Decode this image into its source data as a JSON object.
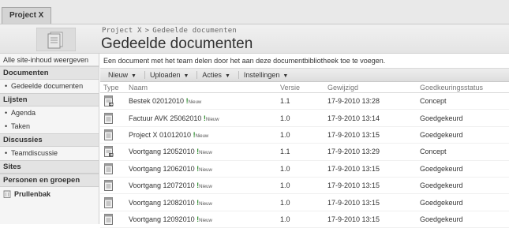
{
  "tab": {
    "label": "Project X"
  },
  "header": {
    "breadcrumb": [
      "Project X",
      "Gedeelde documenten"
    ],
    "breadcrumb_sep": ">",
    "title": "Gedeelde documenten"
  },
  "leftnav": {
    "all_content": "Alle site-inhoud weergeven",
    "sections": [
      {
        "heading": "Documenten",
        "items": [
          "Gedeelde documenten"
        ]
      },
      {
        "heading": "Lijsten",
        "items": [
          "Agenda",
          "Taken"
        ]
      },
      {
        "heading": "Discussies",
        "items": [
          "Teamdiscussie"
        ]
      },
      {
        "heading": "Sites",
        "items": []
      },
      {
        "heading": "Personen en groepen",
        "items": []
      }
    ],
    "recycle": "Prullenbak"
  },
  "main": {
    "description": "Een document met het team delen door het aan deze documentbibliotheek toe te voegen.",
    "toolbar": [
      "Nieuw",
      "Uploaden",
      "Acties",
      "Instellingen"
    ],
    "columns": [
      "Type",
      "Naam",
      "Versie",
      "Gewijzigd",
      "Goedkeuringsstatus"
    ],
    "new_badge": "Nieuw",
    "rows": [
      {
        "icon": "document-checked-out-icon",
        "name": "Bestek 02012010",
        "version": "1.1",
        "modified": "17-9-2010 13:28",
        "status": "Concept"
      },
      {
        "icon": "document-icon",
        "name": "Factuur AVK 25062010",
        "version": "1.0",
        "modified": "17-9-2010 13:14",
        "status": "Goedgekeurd"
      },
      {
        "icon": "document-icon",
        "name": "Project X 01012010",
        "version": "1.0",
        "modified": "17-9-2010 13:15",
        "status": "Goedgekeurd"
      },
      {
        "icon": "document-checked-out-icon",
        "name": "Voortgang 12052010",
        "version": "1.1",
        "modified": "17-9-2010 13:29",
        "status": "Concept"
      },
      {
        "icon": "document-icon",
        "name": "Voortgang 12062010",
        "version": "1.0",
        "modified": "17-9-2010 13:15",
        "status": "Goedgekeurd"
      },
      {
        "icon": "document-icon",
        "name": "Voortgang 12072010",
        "version": "1.0",
        "modified": "17-9-2010 13:15",
        "status": "Goedgekeurd"
      },
      {
        "icon": "document-icon",
        "name": "Voortgang 12082010",
        "version": "1.0",
        "modified": "17-9-2010 13:15",
        "status": "Goedgekeurd"
      },
      {
        "icon": "document-icon",
        "name": "Voortgang 12092010",
        "version": "1.0",
        "modified": "17-9-2010 13:15",
        "status": "Goedgekeurd"
      }
    ]
  },
  "colors": {
    "link": "#1f3f7a",
    "new_mark": "#2a8a2a"
  }
}
